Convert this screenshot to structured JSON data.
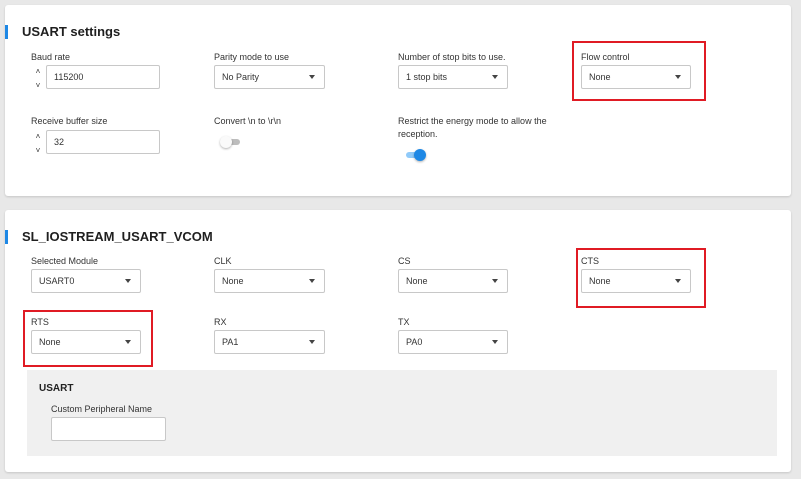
{
  "usart_settings": {
    "title": "USART settings",
    "baud_rate": {
      "label": "Baud rate",
      "value": "115200",
      "up": "˄",
      "down": "˅"
    },
    "parity": {
      "label": "Parity mode to use",
      "value": "No Parity"
    },
    "stop_bits": {
      "label": "Number of stop bits to use.",
      "value": "1 stop bits"
    },
    "flow_control": {
      "label": "Flow control",
      "value": "None"
    },
    "receive_buffer": {
      "label": "Receive buffer size",
      "value": "32",
      "up": "˄",
      "down": "˅"
    },
    "convert_newline": {
      "label": "Convert \\n to \\r\\n",
      "enabled": false
    },
    "restrict_energy": {
      "label_line1": "Restrict the energy mode to allow the",
      "label_line2": "reception.",
      "enabled": true
    }
  },
  "vcom": {
    "title": "SL_IOSTREAM_USART_VCOM",
    "selected_module": {
      "label": "Selected Module",
      "value": "USART0"
    },
    "clk": {
      "label": "CLK",
      "value": "None"
    },
    "cs": {
      "label": "CS",
      "value": "None"
    },
    "cts": {
      "label": "CTS",
      "value": "None"
    },
    "rts": {
      "label": "RTS",
      "value": "None"
    },
    "rx": {
      "label": "RX",
      "value": "PA1"
    },
    "tx": {
      "label": "TX",
      "value": "PA0"
    },
    "usart_panel": {
      "title": "USART",
      "custom_name": {
        "label": "Custom Peripheral Name",
        "value": ""
      }
    }
  },
  "colors": {
    "accent": "#1e88e5",
    "highlight": "#e01b24"
  },
  "icons": {
    "dropdown": "caret-down-icon",
    "spinner": "spinner-arrows-icon"
  }
}
